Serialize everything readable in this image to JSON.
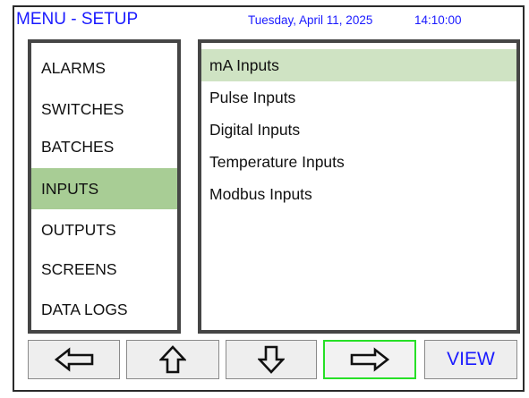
{
  "header": {
    "title": "MENU - SETUP",
    "date": "Tuesday, April 11, 2025",
    "time": "14:10:00"
  },
  "menu": {
    "items": [
      {
        "label": "ALARMS"
      },
      {
        "label": "SWITCHES"
      },
      {
        "label": "BATCHES"
      },
      {
        "label": "INPUTS",
        "selected": true
      },
      {
        "label": "OUTPUTS"
      },
      {
        "label": "SCREENS"
      },
      {
        "label": "DATA LOGS"
      }
    ]
  },
  "submenu": {
    "items": [
      {
        "label": "mA Inputs",
        "selected": true
      },
      {
        "label": "Pulse Inputs"
      },
      {
        "label": "Digital Inputs"
      },
      {
        "label": "Temperature Inputs"
      },
      {
        "label": "Modbus Inputs"
      }
    ]
  },
  "buttons": {
    "left": {
      "icon": "arrow-left-icon"
    },
    "up": {
      "icon": "arrow-up-icon"
    },
    "down": {
      "icon": "arrow-down-icon"
    },
    "right": {
      "icon": "arrow-right-icon",
      "focused": true
    },
    "view": {
      "label": "VIEW"
    }
  },
  "colors": {
    "header_text": "#1a1aff",
    "menu_selected": "#a8cd95",
    "submenu_selected": "#cfe3c3",
    "focus_border": "#27e027",
    "panel_border": "#454545",
    "button_bg": "#eeeeee"
  }
}
